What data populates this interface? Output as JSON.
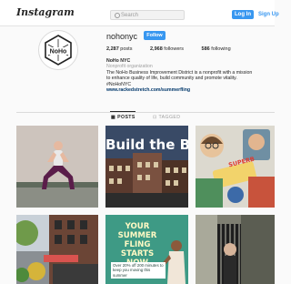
{
  "header": {
    "logo_text": "Instagram",
    "search_placeholder": "Search",
    "login_label": "Log In",
    "signup_label": "Sign Up"
  },
  "profile": {
    "avatar_text": "NoHo",
    "username": "nohonyc",
    "follow_label": "Follow",
    "stats": {
      "posts_count": "2,287",
      "posts_label": "posts",
      "followers_count": "2,968",
      "followers_label": "followers",
      "following_count": "586",
      "following_label": "following"
    },
    "bio": {
      "name": "NoHo NYC",
      "category": "Nonprofit organization",
      "line1": "The NoHo Business Improvement District is a nonprofit with a mission",
      "line2": "to enhance quality of life, build community and promote vitality.",
      "hashtag": "#NoHoNYC",
      "link": "www.rackedstretch.com/summerfling"
    }
  },
  "tabs": {
    "posts_label": "POSTS",
    "tagged_label": "TAGGED"
  },
  "posts": {
    "tile2_title": "Build the Blo",
    "tile3_caption": "SUPERB",
    "tile5_title": "YOUR SUMMER FLING STARTS NOW",
    "tile5_sub": "Over 20% off 200 minutes to keep you moving this summer"
  },
  "colors": {
    "accent_blue": "#3897f0",
    "link_blue": "#00376b",
    "fling_green": "#3e9a85"
  }
}
